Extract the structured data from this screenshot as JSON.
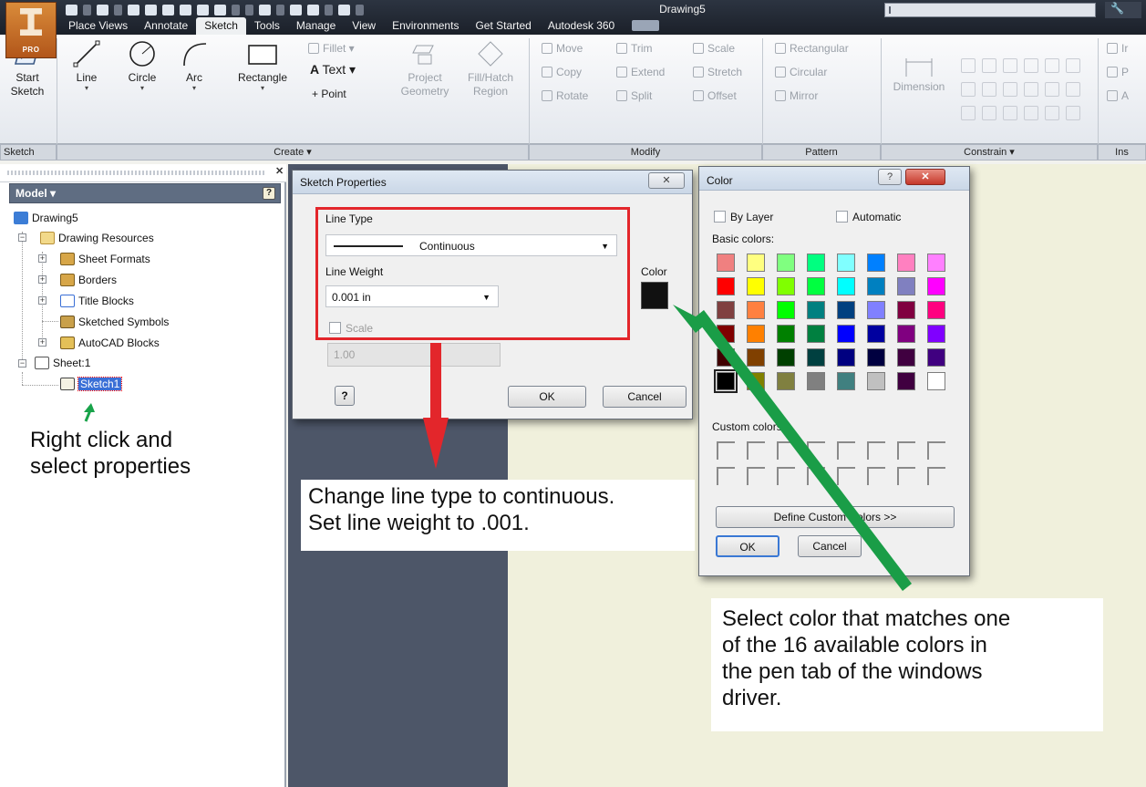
{
  "app": {
    "badge": "PRO",
    "document_title": "Drawing5"
  },
  "ribbon": {
    "tabs": [
      "Place Views",
      "Annotate",
      "Sketch",
      "Tools",
      "Manage",
      "View",
      "Environments",
      "Get Started",
      "Autodesk 360"
    ],
    "active_tab": "Sketch",
    "panels": {
      "sketch": "Sketch",
      "create": "Create ▾",
      "modify": "Modify",
      "pattern": "Pattern",
      "constrain": "Constrain ▾",
      "insert": "Ins"
    },
    "tools": {
      "start_sketch": "Start\nSketch",
      "line": "Line",
      "circle": "Circle",
      "arc": "Arc",
      "rectangle": "Rectangle",
      "fillet": "Fillet ▾",
      "text": "Text ▾",
      "point": "Point",
      "project_geometry_1": "Project",
      "project_geometry_2": "Geometry",
      "fill_hatch_1": "Fill/Hatch",
      "fill_hatch_2": "Region",
      "move": "Move",
      "trim": "Trim",
      "scale": "Scale",
      "copy": "Copy",
      "extend": "Extend",
      "stretch": "Stretch",
      "rotate": "Rotate",
      "split": "Split",
      "offset": "Offset",
      "rectangular": "Rectangular",
      "circular": "Circular",
      "mirror": "Mirror",
      "dimension": "Dimension",
      "insert_1": "Ir",
      "insert_2": "P",
      "insert_3": "A"
    }
  },
  "browser": {
    "header": "Model ▾",
    "tree": {
      "root": "Drawing5",
      "resources": "Drawing Resources",
      "sheet_formats": "Sheet Formats",
      "borders": "Borders",
      "title_blocks": "Title Blocks",
      "sketched_symbols": "Sketched Symbols",
      "autocad_blocks": "AutoCAD Blocks",
      "sheet": "Sheet:1",
      "sketch": "Sketch1"
    }
  },
  "sketch_properties": {
    "title": "Sketch Properties",
    "line_type_label": "Line Type",
    "line_type_value": "Continuous",
    "line_weight_label": "Line Weight",
    "line_weight_value": "0.001 in",
    "scale_label": "Scale",
    "scale_value": "1.00",
    "color_label": "Color",
    "color_value": "#111111",
    "ok": "OK",
    "cancel": "Cancel"
  },
  "color_dialog": {
    "title": "Color",
    "by_layer": "By Layer",
    "automatic": "Automatic",
    "basic_colors_label": "Basic colors:",
    "custom_colors_label": "Custom colors:",
    "define_custom": "Define Custom Colors >>",
    "ok": "OK",
    "cancel": "Cancel",
    "basic_colors": [
      "#f08080",
      "#ffff80",
      "#80ff80",
      "#00ff80",
      "#80ffff",
      "#0080ff",
      "#ff80c0",
      "#ff80ff",
      "#ff0000",
      "#ffff00",
      "#80ff00",
      "#00ff40",
      "#00ffff",
      "#0080c0",
      "#8080c0",
      "#ff00ff",
      "#804040",
      "#ff8040",
      "#00ff00",
      "#008080",
      "#004080",
      "#8080ff",
      "#800040",
      "#ff0080",
      "#800000",
      "#ff8000",
      "#008000",
      "#008040",
      "#0000ff",
      "#0000a0",
      "#800080",
      "#8000ff",
      "#400000",
      "#804000",
      "#004000",
      "#004040",
      "#000080",
      "#000040",
      "#400040",
      "#400080",
      "#000000",
      "#808000",
      "#808040",
      "#808080",
      "#408080",
      "#c0c0c0",
      "#400040",
      "#ffffff"
    ],
    "selected_index": 40
  },
  "annotations": {
    "right_click": "Right click and\nselect properties",
    "line_type": "Change line type to continuous.\nSet line weight to .001.",
    "color": "Select color that matches one\nof the 16 available colors in\nthe pen tab of the windows\ndriver."
  }
}
